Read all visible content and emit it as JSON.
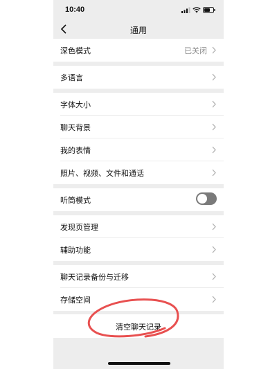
{
  "status_bar": {
    "time": "10:40"
  },
  "nav": {
    "title": "通用"
  },
  "sections": [
    {
      "rows": [
        {
          "label": "深色模式",
          "value": "已关闭"
        }
      ]
    },
    {
      "rows": [
        {
          "label": "多语言"
        }
      ]
    },
    {
      "rows": [
        {
          "label": "字体大小"
        },
        {
          "label": "聊天背景"
        },
        {
          "label": "我的表情"
        },
        {
          "label": "照片、视频、文件和通话"
        }
      ]
    },
    {
      "rows": [
        {
          "label": "听筒模式",
          "toggle": false
        }
      ]
    },
    {
      "rows": [
        {
          "label": "发现页管理"
        },
        {
          "label": "辅助功能"
        }
      ]
    },
    {
      "rows": [
        {
          "label": "聊天记录备份与迁移"
        },
        {
          "label": "存储空间"
        }
      ]
    }
  ],
  "clear_history": {
    "label": "清空聊天记录"
  },
  "annotation_color": "#e85050"
}
